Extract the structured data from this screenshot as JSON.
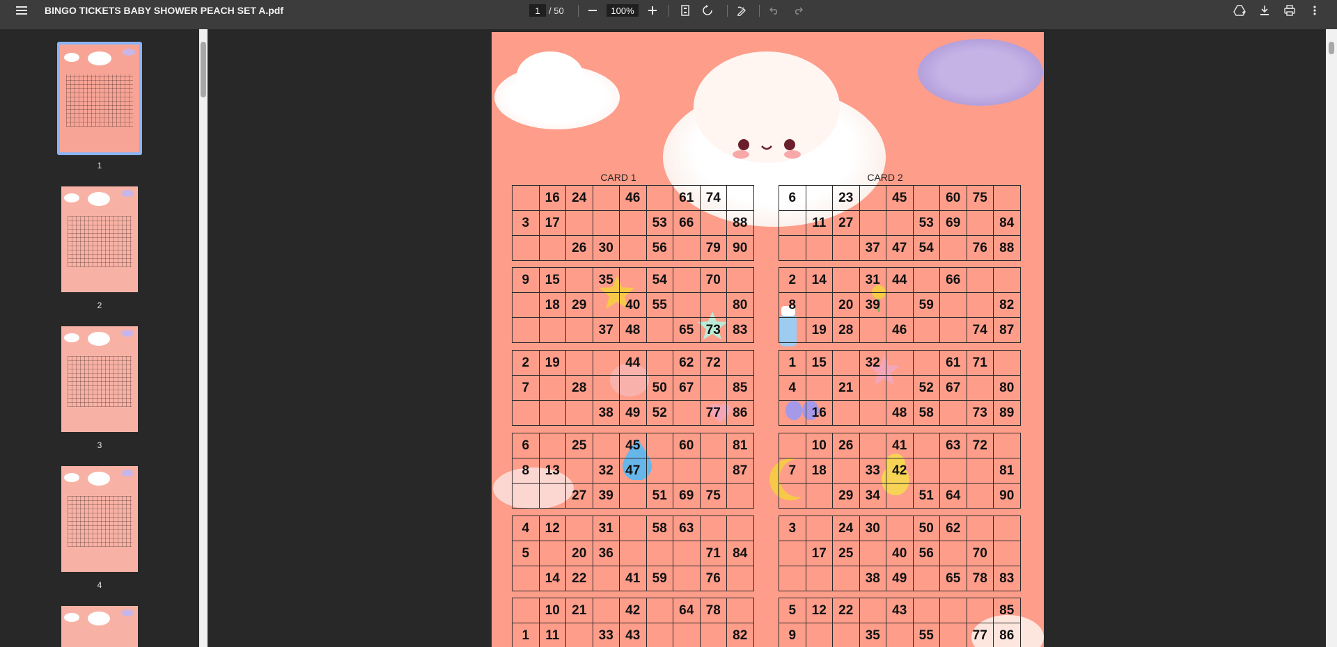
{
  "toolbar": {
    "title": "BINGO TICKETS BABY SHOWER PEACH SET A.pdf",
    "page_current": "1",
    "page_total": "/ 50",
    "zoom": "100%"
  },
  "thumbnails": [
    {
      "label": "1"
    },
    {
      "label": "2"
    },
    {
      "label": "3"
    },
    {
      "label": "4"
    }
  ],
  "colors": {
    "page": "#fd9d8a",
    "toolbar": "#3c3c3c",
    "selected_thumb": "#8ab4f8"
  },
  "cards": [
    {
      "title": "CARD 1",
      "blocks": [
        [
          [
            "",
            "16",
            "24",
            "",
            "46",
            "",
            "61",
            "74",
            ""
          ],
          [
            "3",
            "17",
            "",
            "",
            "",
            "53",
            "66",
            "",
            "88"
          ],
          [
            "",
            "",
            "26",
            "30",
            "",
            "56",
            "",
            "79",
            "90"
          ]
        ],
        [
          [
            "9",
            "15",
            "",
            "35",
            "",
            "54",
            "",
            "70",
            ""
          ],
          [
            "",
            "18",
            "29",
            "",
            "40",
            "55",
            "",
            "",
            "80"
          ],
          [
            "",
            "",
            "",
            "37",
            "48",
            "",
            "65",
            "73",
            "83"
          ]
        ],
        [
          [
            "2",
            "19",
            "",
            "",
            "44",
            "",
            "62",
            "72",
            ""
          ],
          [
            "7",
            "",
            "28",
            "",
            "",
            "50",
            "67",
            "",
            "85"
          ],
          [
            "",
            "",
            "",
            "38",
            "49",
            "52",
            "",
            "77",
            "86"
          ]
        ],
        [
          [
            "6",
            "",
            "25",
            "",
            "45",
            "",
            "60",
            "",
            "81"
          ],
          [
            "8",
            "13",
            "",
            "32",
            "47",
            "",
            "",
            "",
            "87"
          ],
          [
            "",
            "",
            "27",
            "39",
            "",
            "51",
            "69",
            "75",
            ""
          ]
        ],
        [
          [
            "4",
            "12",
            "",
            "31",
            "",
            "58",
            "63",
            "",
            ""
          ],
          [
            "5",
            "",
            "20",
            "36",
            "",
            "",
            "",
            "71",
            "84"
          ],
          [
            "",
            "14",
            "22",
            "",
            "41",
            "59",
            "",
            "76",
            ""
          ]
        ],
        [
          [
            "",
            "10",
            "21",
            "",
            "42",
            "",
            "64",
            "78",
            ""
          ],
          [
            "1",
            "11",
            "",
            "33",
            "43",
            "",
            "",
            "",
            "82"
          ]
        ]
      ]
    },
    {
      "title": "CARD 2",
      "blocks": [
        [
          [
            "6",
            "",
            "23",
            "",
            "45",
            "",
            "60",
            "75",
            ""
          ],
          [
            "",
            "11",
            "27",
            "",
            "",
            "53",
            "69",
            "",
            "84"
          ],
          [
            "",
            "",
            "",
            "37",
            "47",
            "54",
            "",
            "76",
            "88"
          ]
        ],
        [
          [
            "2",
            "14",
            "",
            "31",
            "44",
            "",
            "66",
            "",
            ""
          ],
          [
            "8",
            "",
            "20",
            "39",
            "",
            "59",
            "",
            "",
            "82"
          ],
          [
            "",
            "19",
            "28",
            "",
            "46",
            "",
            "",
            "74",
            "87"
          ]
        ],
        [
          [
            "1",
            "15",
            "",
            "32",
            "",
            "",
            "61",
            "71",
            ""
          ],
          [
            "4",
            "",
            "21",
            "",
            "",
            "52",
            "67",
            "",
            "80"
          ],
          [
            "",
            "16",
            "",
            "",
            "48",
            "58",
            "",
            "73",
            "89"
          ]
        ],
        [
          [
            "",
            "10",
            "26",
            "",
            "41",
            "",
            "63",
            "72",
            ""
          ],
          [
            "7",
            "18",
            "",
            "33",
            "42",
            "",
            "",
            "",
            "81"
          ],
          [
            "",
            "",
            "29",
            "34",
            "",
            "51",
            "64",
            "",
            "90"
          ]
        ],
        [
          [
            "3",
            "",
            "24",
            "30",
            "",
            "50",
            "62",
            "",
            ""
          ],
          [
            "",
            "17",
            "25",
            "",
            "40",
            "56",
            "",
            "70",
            ""
          ],
          [
            "",
            "",
            "",
            "38",
            "49",
            "",
            "65",
            "78",
            "83"
          ]
        ],
        [
          [
            "5",
            "12",
            "22",
            "",
            "43",
            "",
            "",
            "",
            "85"
          ],
          [
            "9",
            "",
            "",
            "35",
            "",
            "55",
            "",
            "77",
            "86"
          ]
        ]
      ]
    }
  ]
}
